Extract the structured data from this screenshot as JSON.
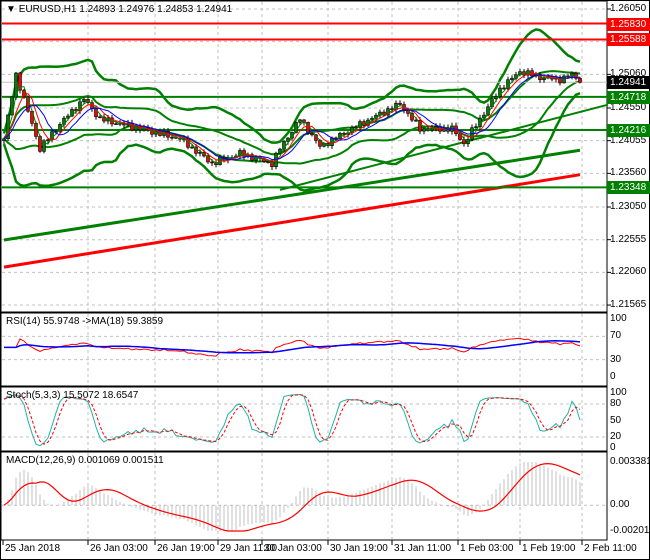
{
  "header": {
    "symbol": "EURUSD,H1",
    "open": "1.24893",
    "high": "1.24976",
    "low": "1.24853",
    "close": "1.24941"
  },
  "main_axis": [
    "1.26050",
    "1.25555",
    "1.25060",
    "1.24550",
    "1.24055",
    "1.23560",
    "1.23050",
    "1.22555",
    "1.22060",
    "1.21565"
  ],
  "levels": [
    {
      "price": "1.25830",
      "color": "#ff0000"
    },
    {
      "price": "1.25588",
      "color": "#ff0000"
    },
    {
      "price": "1.24718",
      "color": "#008000"
    },
    {
      "price": "1.24216",
      "color": "#008000"
    },
    {
      "price": "1.23348",
      "color": "#008000"
    }
  ],
  "current_price": {
    "price": "1.24941",
    "color": "#000000"
  },
  "rsi": {
    "label": "RSI(14) 55.9748  ->MA(18) 59.3859",
    "axis": [
      "100",
      "70",
      "30",
      "0"
    ]
  },
  "stoch": {
    "label": "Stoch(5,3,3) 15.5072 18.6547",
    "axis": [
      "100",
      "80",
      "50",
      "20",
      "0"
    ]
  },
  "macd": {
    "label": "MACD(12,26,9) 0.001069 0.001511",
    "axis": [
      "0.003381",
      "0.00",
      "-0.002013"
    ]
  },
  "time_axis": [
    "25 Jan 2018",
    "26 Jan 03:00",
    "26 Jan 19:00",
    "29 Jan 11:00",
    "30 Jan 03:00",
    "30 Jan 19:00",
    "31 Jan 11:00",
    "1 Feb 03:00",
    "1 Feb 19:00",
    "2 Feb 11:00"
  ],
  "colors": {
    "bull": "#008000",
    "bear": "#ff0000",
    "band": "#008000",
    "grid": "#c0c0c0",
    "ma_fast": "#ff0000",
    "ma_mid": "#0000ff",
    "rsi": "#ff0000",
    "rsi_ma": "#0000ff",
    "stoch_k": "#20b2aa",
    "stoch_d": "#ff0000",
    "macd_hist": "#c0c0c0",
    "macd_signal": "#ff0000"
  },
  "chart_data": {
    "type": "candlestick",
    "symbol": "EURUSD",
    "timeframe": "H1",
    "candle_count": 145,
    "close_anchors": [
      [
        0,
        1.24085
      ],
      [
        3,
        1.2506
      ],
      [
        5,
        1.24685
      ],
      [
        9,
        1.23935
      ],
      [
        14,
        1.2431
      ],
      [
        20,
        1.24685
      ],
      [
        24,
        1.24385
      ],
      [
        34,
        1.24235
      ],
      [
        44,
        1.24085
      ],
      [
        52,
        1.2371
      ],
      [
        59,
        1.2386
      ],
      [
        67,
        1.2371
      ],
      [
        69,
        1.23935
      ],
      [
        74,
        1.24385
      ],
      [
        79,
        1.23965
      ],
      [
        87,
        1.24235
      ],
      [
        94,
        1.2446
      ],
      [
        99,
        1.2461
      ],
      [
        104,
        1.24235
      ],
      [
        112,
        1.24235
      ],
      [
        115,
        1.2401
      ],
      [
        119,
        1.24385
      ],
      [
        124,
        1.24835
      ],
      [
        129,
        1.25105
      ],
      [
        134,
        1.25015
      ],
      [
        139,
        1.24985
      ],
      [
        142,
        1.2506
      ],
      [
        144,
        1.24941
      ]
    ],
    "trendlines": [
      {
        "name": "green-long-ma",
        "from": [
          0,
          1.2255
        ],
        "to": [
          144,
          1.2391
        ],
        "color": "#008000"
      },
      {
        "name": "red-long-ma",
        "from": [
          0,
          1.2214
        ],
        "to": [
          144,
          1.2354
        ],
        "color": "#ff0000"
      },
      {
        "name": "green-trendline",
        "from": [
          69,
          1.2331
        ],
        "to": [
          151,
          1.246
        ],
        "color": "#008000"
      }
    ],
    "price_range": [
      1.21565,
      1.2605
    ]
  }
}
